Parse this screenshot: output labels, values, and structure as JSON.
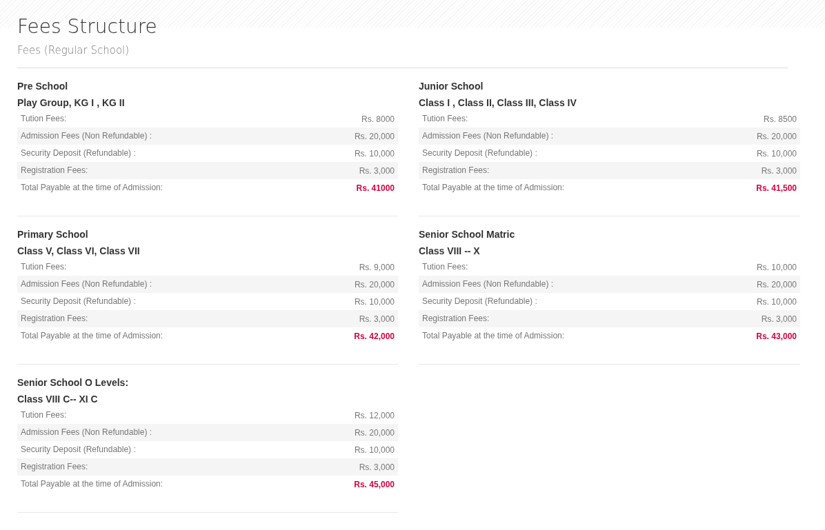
{
  "title": "Fees Structure",
  "subtitle": "Fees (Regular School)",
  "sections": [
    {
      "heading": "Pre School",
      "classes": "Play Group, KG I , KG II",
      "rows": [
        {
          "kind": "fee",
          "label": "Tution Fees:",
          "amount": "Rs. 8000"
        },
        {
          "kind": "fee",
          "label": "Admission Fees (Non Refundable) :",
          "amount": "Rs. 20,000"
        },
        {
          "kind": "fee",
          "label": "Security Deposit (Refundable) :",
          "amount": "Rs. 10,000"
        },
        {
          "kind": "fee",
          "label": "Registration Fees:",
          "amount": "Rs. 3,000"
        },
        {
          "kind": "total",
          "label": "Total Payable at the time of Admission:",
          "amount": "Rs. 41000"
        }
      ]
    },
    {
      "heading": "Junior School",
      "classes": "Class I , Class II, Class III, Class IV",
      "rows": [
        {
          "kind": "fee",
          "label": "Tution Fees:",
          "amount": "Rs. 8500"
        },
        {
          "kind": "fee",
          "label": "Admission Fees (Non Refundable) :",
          "amount": "Rs. 20,000"
        },
        {
          "kind": "fee",
          "label": "Security Deposit (Refundable) :",
          "amount": "Rs. 10,000"
        },
        {
          "kind": "fee",
          "label": "Registration Fees:",
          "amount": "Rs. 3,000"
        },
        {
          "kind": "total",
          "label": "Total Payable at the time of Admission:",
          "amount": "Rs. 41,500"
        }
      ]
    },
    {
      "heading": "Primary School",
      "classes": "Class V, Class VI, Class VII",
      "rows": [
        {
          "kind": "fee",
          "label": "Tution Fees:",
          "amount": "Rs. 9,000"
        },
        {
          "kind": "fee",
          "label": "Admission Fees (Non Refundable) :",
          "amount": "Rs. 20,000"
        },
        {
          "kind": "fee",
          "label": "Security Deposit (Refundable) :",
          "amount": "Rs. 10,000"
        },
        {
          "kind": "fee",
          "label": "Registration Fees:",
          "amount": "Rs. 3,000"
        },
        {
          "kind": "total",
          "label": "Total Payable at the time of Admission:",
          "amount": "Rs. 42,000"
        }
      ]
    },
    {
      "heading": "Senior School Matric",
      "classes": "Class VIII -- X",
      "rows": [
        {
          "kind": "fee",
          "label": "Tution Fees:",
          "amount": "Rs. 10,000"
        },
        {
          "kind": "fee",
          "label": "Admission Fees (Non Refundable) :",
          "amount": "Rs. 20,000"
        },
        {
          "kind": "fee",
          "label": "Security Deposit (Refundable) :",
          "amount": "Rs. 10,000"
        },
        {
          "kind": "fee",
          "label": "Registration Fees:",
          "amount": "Rs. 3,000"
        },
        {
          "kind": "total",
          "label": "Total Payable at the time of Admission:",
          "amount": "Rs. 43,000"
        }
      ]
    },
    {
      "heading": "Senior School O Levels:",
      "classes": "Class VIII C-- XI C",
      "rows": [
        {
          "kind": "fee",
          "label": "Tution Fees:",
          "amount": "Rs. 12,000"
        },
        {
          "kind": "fee",
          "label": "Admission Fees (Non Refundable) :",
          "amount": "Rs. 20,000"
        },
        {
          "kind": "fee",
          "label": "Security Deposit (Refundable) :",
          "amount": "Rs. 10,000"
        },
        {
          "kind": "fee",
          "label": "Registration Fees:",
          "amount": "Rs. 3,000"
        },
        {
          "kind": "total",
          "label": "Total Payable at the time of Admission:",
          "amount": "Rs. 45,000"
        }
      ]
    }
  ]
}
